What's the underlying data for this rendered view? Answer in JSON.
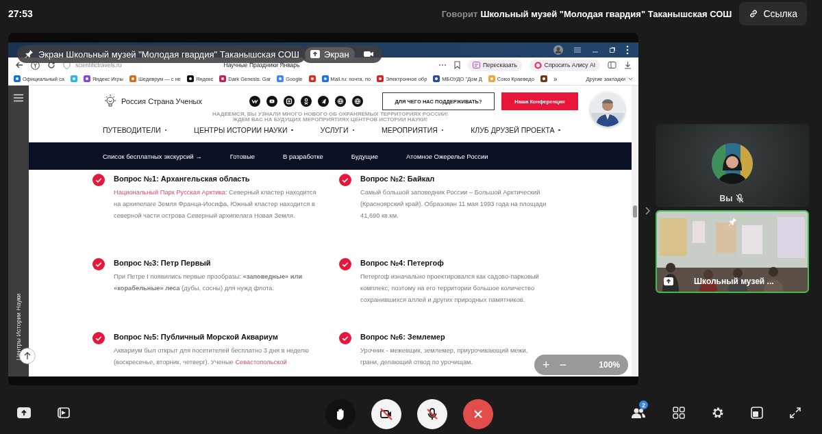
{
  "top_bar": {
    "timer": "27:53",
    "speaker_label": "Говорит",
    "speaker_name": "Школьный музей \"Молодая гвардия\" Таканышская СОШ",
    "link_button": "Ссылка"
  },
  "screen_share": {
    "presenter_label": "Экран Школьный музей \"Молодая гвардия\" Таканышская СОШ",
    "screen_button": "Экран",
    "browser": {
      "url": "scientifictravels.ru",
      "page_title": "Научные Праздники Январь",
      "actions": [
        "Пересказать",
        "Спросить Алису AI"
      ],
      "bookmarks": [
        {
          "kind": "link",
          "label": "Официальный са"
        },
        {
          "kind": "icon"
        },
        {
          "kind": "link",
          "label": "Яндекс Игры"
        },
        {
          "kind": "link",
          "label": "Шедеврум — с не"
        },
        {
          "kind": "link",
          "label": "Яндекс"
        },
        {
          "kind": "link",
          "label": "Dark Genesis. Gar"
        },
        {
          "kind": "link",
          "label": "Google"
        },
        {
          "kind": "icon"
        },
        {
          "kind": "link",
          "label": "Mail.ru: почта, по"
        },
        {
          "kind": "link",
          "label": "Электронное обр"
        },
        {
          "kind": "link",
          "label": "МБОУДО \"Дом Д"
        },
        {
          "kind": "link",
          "label": "Союз Краеведо"
        },
        {
          "kind": "icon"
        }
      ],
      "more_bookmarks": "»",
      "other_bookmarks": "Другие закладки"
    },
    "site": {
      "sidebar_label": "Центры Истории Науки",
      "logo": "Россия Страна Ученых",
      "support_button": "ДЛЯ ЧЕГО НАС ПОДДЕРЖИВАТЬ?",
      "conference_button": "Наша Конференция",
      "banner": [
        "НАДЕЕМСЯ, ВЫ УЗНАЛИ МНОГО НОВОГО ОБ ОХРАНЯЕМЫХ ТЕРРИТОРИЯХ РОССИИ!",
        "ЖДЕМ ВАС НА БУДУЩИХ МЕРОПРИЯТИЯХ ЦЕНТРОВ ИСТОРИИ НАУКИ!"
      ],
      "menu": [
        "ПУТЕВОДИТЕЛИ",
        "ЦЕНТРЫ ИСТОРИИ НАУКИ",
        "УСЛУГИ",
        "МЕРОПРИЯТИЯ",
        "КЛУБ ДРУЗЕЙ ПРОЕКТА"
      ],
      "submenu": [
        "Список бесплатных экскурсий →",
        "Готовые",
        "В разработке",
        "Будущие",
        "Атомное Ожерелье России"
      ],
      "questions": [
        {
          "title": "Вопрос №1: Архангельская область",
          "checked": true,
          "parts": [
            {
              "kind": "link",
              "text": "Национальный Парк Русская Арктика"
            },
            {
              "kind": "plain",
              "text": ": Северный кластер находится на архипелаге Земля Франца-Иосифа, Южный кластер находится в северной части острова Северный архипелага Новая Земля."
            }
          ]
        },
        {
          "title": "Вопрос №2: Байкал",
          "checked": true,
          "parts": [
            {
              "kind": "plain",
              "text": "Самый большой заповедник России – Большой Арктический (Красноярский край). Образован 11 мая 1993 года на площади 41,690 кв.км."
            }
          ]
        },
        {
          "title": "Вопрос №3: Петр Первый",
          "checked": true,
          "parts": [
            {
              "kind": "plain",
              "text": "При Петре I появились первые прообразы: **«заповедные» или «корабельные» леса** (дубы, сосны) для нужд флота."
            }
          ]
        },
        {
          "title": "Вопрос №4: Петергоф",
          "checked": true,
          "parts": [
            {
              "kind": "plain",
              "text": "Петергоф изначально проектировался как садово-парковый комплекс, поэтому на его территории большое количество сохранившихся аллей и других природных памятников."
            }
          ]
        },
        {
          "title": "Вопрос №5: Публичный Морской Аквариум",
          "checked": true,
          "parts": [
            {
              "kind": "plain",
              "text": "Аквариум был открыт для посетителей бесплатно 3 дня в неделю (воскресенье, вторник, четверг). Ученые "
            },
            {
              "kind": "link",
              "text": "Севастопольской"
            }
          ]
        },
        {
          "title": "Вопрос №6: Землемер",
          "checked": true,
          "parts": [
            {
              "kind": "plain",
              "text": "Урочник - межевщик, землемер, приурочивающий межи, грани, делающий отвод по урочищам."
            }
          ]
        }
      ],
      "zoom": {
        "zoom_in": "+",
        "zoom_out": "−",
        "value": "100%"
      }
    }
  },
  "participants": [
    {
      "kind": "avatar",
      "name": "Вы",
      "muted": true,
      "speaking": false
    },
    {
      "kind": "video",
      "name": "Школьный музей ...",
      "muted": false,
      "speaking": true,
      "pinned": true,
      "sharing": true
    }
  ],
  "toolbar": {
    "camera": false,
    "microphone": false,
    "participants_badge": "2"
  }
}
